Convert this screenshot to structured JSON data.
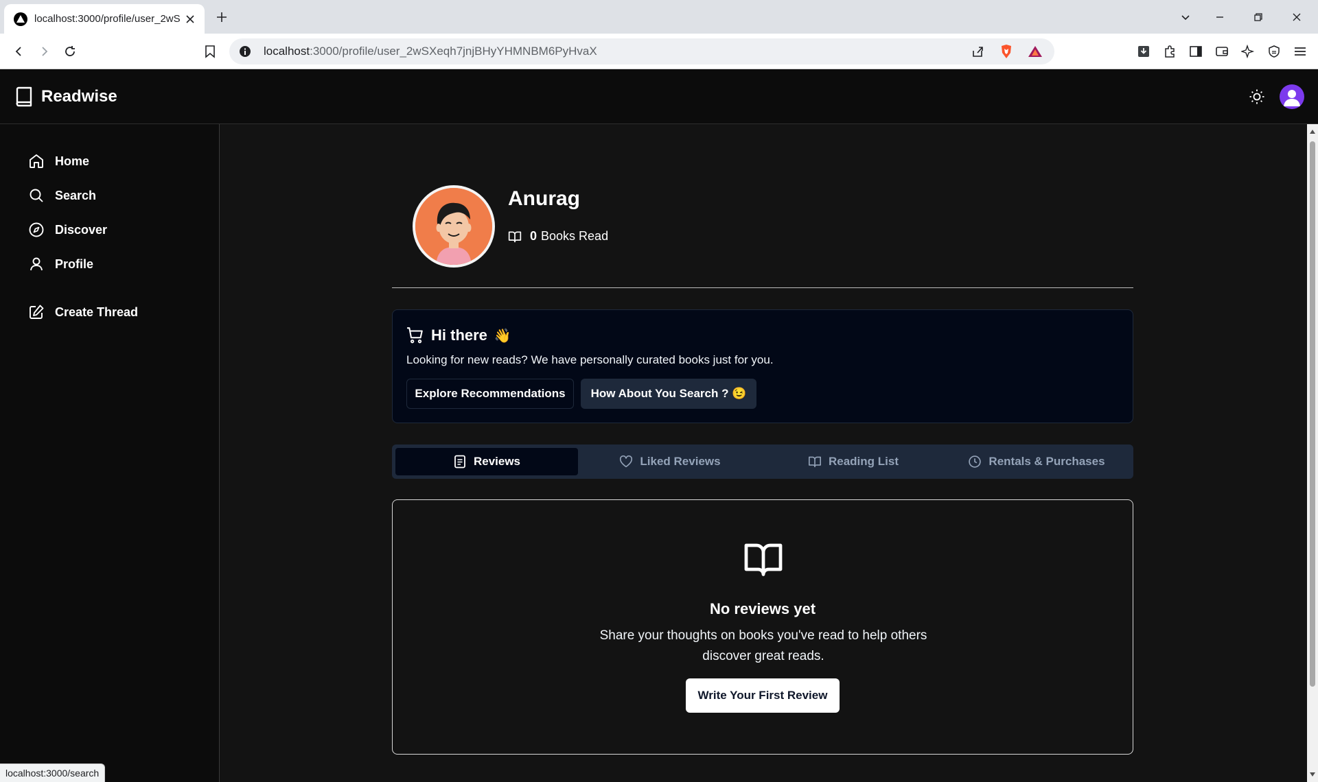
{
  "browser": {
    "tab_title": "localhost:3000/profile/user_2wS",
    "url_host": "localhost",
    "url_rest": ":3000/profile/user_2wSXeqh7jnjBHyYHMNBM6PyHvaX",
    "status_url": "localhost:3000/search"
  },
  "app": {
    "brand": "Readwise"
  },
  "sidebar": {
    "items": [
      {
        "label": "Home",
        "icon": "home-icon"
      },
      {
        "label": "Search",
        "icon": "search-icon"
      },
      {
        "label": "Discover",
        "icon": "compass-icon"
      },
      {
        "label": "Profile",
        "icon": "user-icon"
      },
      {
        "label": "Create Thread",
        "icon": "edit-icon"
      }
    ]
  },
  "profile": {
    "name": "Anurag",
    "books_read_count": "0",
    "books_read_label": "Books Read"
  },
  "greeting": {
    "title": "Hi there",
    "emoji": "👋",
    "message": "Looking for new reads? We have personally curated books just for you.",
    "explore_label": "Explore Recommendations",
    "search_label": "How About You Search ? 😉"
  },
  "tabs": [
    {
      "label": "Reviews",
      "icon": "document-icon",
      "active": true
    },
    {
      "label": "Liked Reviews",
      "icon": "heart-icon",
      "active": false
    },
    {
      "label": "Reading List",
      "icon": "book-open-icon",
      "active": false
    },
    {
      "label": "Rentals & Purchases",
      "icon": "clock-icon",
      "active": false
    }
  ],
  "empty_state": {
    "title": "No reviews yet",
    "message": "Share your thoughts on books you've read to help others discover great reads.",
    "button_label": "Write Your First Review"
  },
  "colors": {
    "background": "#131313",
    "card_background": "#020817",
    "tab_bar": "#1e293b",
    "avatar_orange": "#f07d4a",
    "user_avatar": "#7c3aed"
  }
}
